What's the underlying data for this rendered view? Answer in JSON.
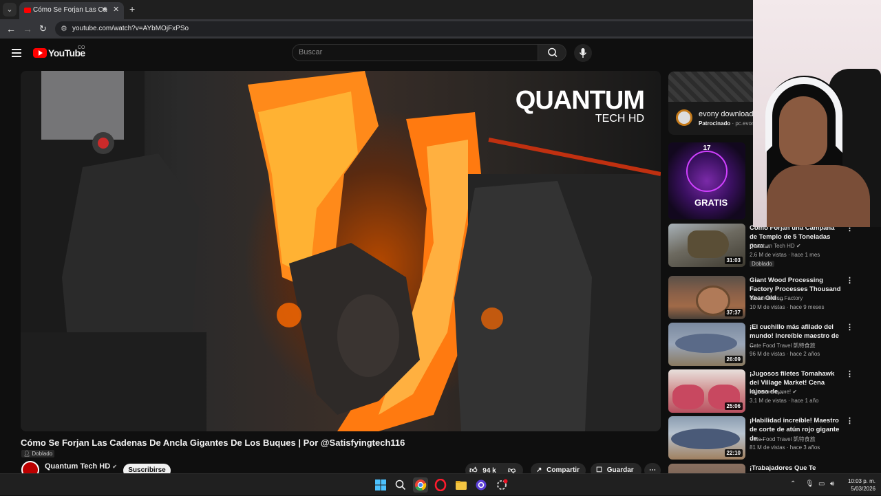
{
  "browser": {
    "tab_title": "Cómo Se Forjan Las Cadenas",
    "url": "youtube.com/watch?v=AYbMOjFxPSo"
  },
  "youtube": {
    "logo_text": "YouTube",
    "country_code": "CO",
    "search_placeholder": "Buscar",
    "brand_color": "#ff0000"
  },
  "player": {
    "watermark_name": "QUANTUM",
    "watermark_sub": "TECH HD"
  },
  "video": {
    "title": "Cómo Se Forjan Las Cadenas De Ancla Gigantes De Los Buques | Por @Satisfyingtech116",
    "dubbed_label": "Doblado",
    "channel": "Quantum Tech HD",
    "subscribe_label": "Suscribirse",
    "likes": "94 k",
    "share_label": "Compartir",
    "save_label": "Guardar"
  },
  "ad": {
    "title": "evony download",
    "sponsored": "Patrocinado",
    "domain": "pc.evon"
  },
  "recommendations": [
    {
      "title": "Cómo Forjan una Campana de Templo de 5 Toneladas para ...",
      "channel": "Quantum Tech HD",
      "meta": "2.6 M de vistas · hace 1 mes",
      "duration": "31:03",
      "badge": "Doblado"
    },
    {
      "title": "Giant Wood Processing Factory Processes Thousand Year Old ...",
      "channel": "Woodworking Factory",
      "meta": "10 M de vistas · hace 9 meses",
      "duration": "37:37"
    },
    {
      "title": "¡El cuchillo más afilado del mundo! Increíble maestro de ...",
      "channel": "Cate Food Travel 凱特食旅",
      "meta": "96 M de vistas · hace 2 años",
      "duration": "26:09"
    },
    {
      "title": "¡Jugosos filetes Tomahawk del Village Market! Cena lujosa de...",
      "channel": "Мужик на кухне!",
      "meta": "3.1 M de vistas · hace 1 año",
      "duration": "25:06"
    },
    {
      "title": "¡Habilidad increíble! Maestro de corte de atún rojo gigante de ...",
      "channel": "Cate Food Travel 凱特食旅",
      "meta": "81 M de vistas · hace 3 años",
      "duration": "22:10"
    },
    {
      "title": "¡Trabajadores Que Te Pondrán"
    }
  ],
  "promo_thumb": {
    "badge_number": "17",
    "word": "GRATIS"
  },
  "clock": {
    "time": "10:03 p. m.",
    "date": "5/03/2026"
  }
}
